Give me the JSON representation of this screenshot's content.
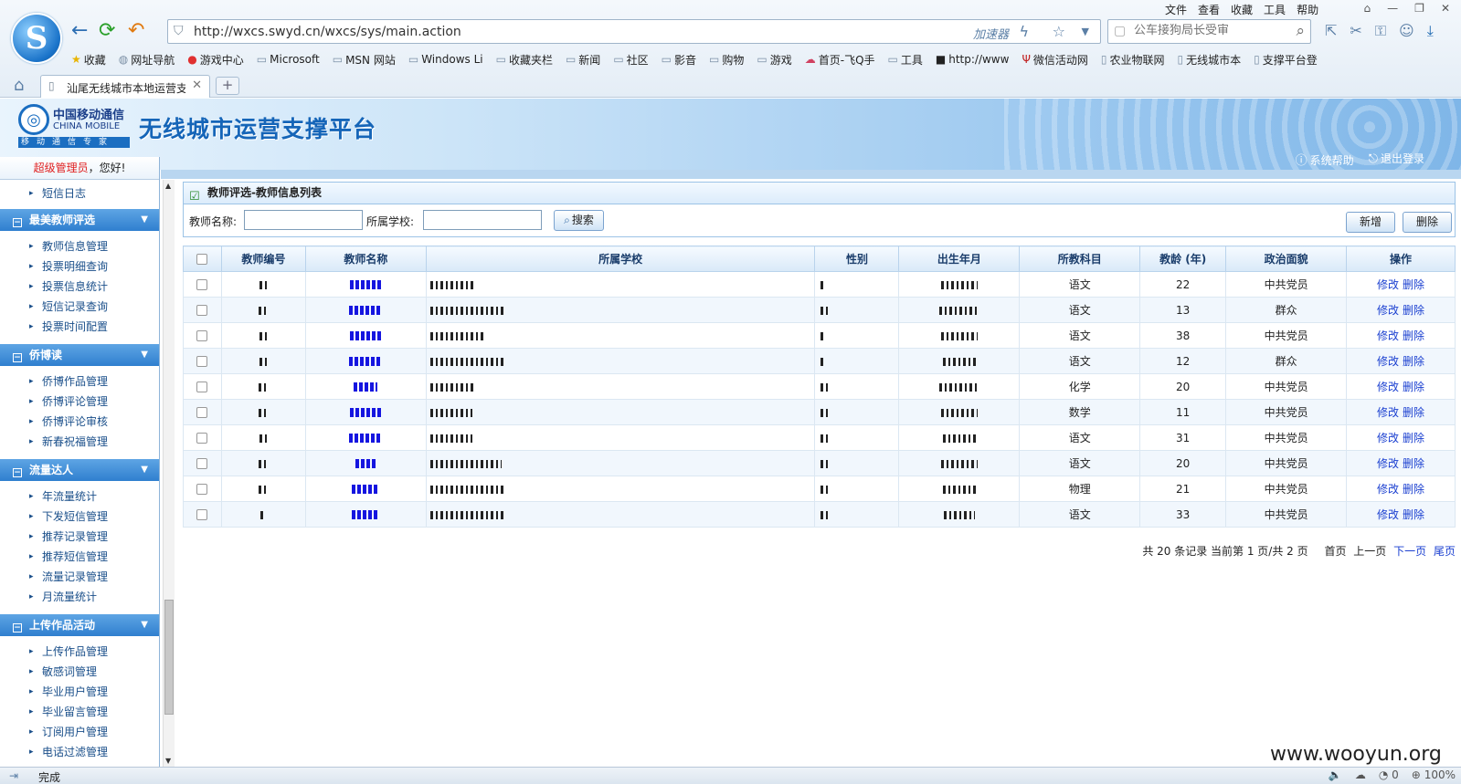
{
  "browser": {
    "url": "http://wxcs.swyd.cn/wxcs/sys/main.action",
    "accelerator_label": "加速器",
    "search_placeholder": "公车接狗局长受审",
    "menu": [
      "文件",
      "查看",
      "收藏",
      "工具",
      "帮助"
    ],
    "favorites": [
      "收藏",
      "网址导航",
      "游戏中心",
      "Microsoft",
      "MSN 网站",
      "Windows Li",
      "收藏夹栏",
      "新闻",
      "社区",
      "影音",
      "购物",
      "游戏",
      "首页-飞Q手",
      "工具",
      "http://www",
      "微信活动网",
      "农业物联网",
      "无线城市本",
      "支撑平台登"
    ],
    "tab_title": "汕尾无线城市本地运营支",
    "new_tab": "+",
    "status": "完成",
    "status_right": [
      "0",
      "100%"
    ]
  },
  "header": {
    "logo_cn": "中国移动通信",
    "logo_en": "CHINA MOBILE",
    "logo_sub": "移动通信专家",
    "title": "无线城市运营支撑平台",
    "help_link": "系统帮助",
    "logout_link": "退出登录"
  },
  "sidebar": {
    "welcome_role": "超级管理员",
    "welcome_suffix": "，您好!",
    "top_items": [
      "短信日志"
    ],
    "groups": [
      {
        "title": "最美教师评选",
        "items": [
          "教师信息管理",
          "投票明细查询",
          "投票信息统计",
          "短信记录查询",
          "投票时间配置"
        ]
      },
      {
        "title": "侨博读",
        "items": [
          "侨博作品管理",
          "侨博评论管理",
          "侨博评论审核",
          "新春祝福管理"
        ]
      },
      {
        "title": "流量达人",
        "items": [
          "年流量统计",
          "下发短信管理",
          "推荐记录管理",
          "推荐短信管理",
          "流量记录管理",
          "月流量统计"
        ]
      },
      {
        "title": "上传作品活动",
        "items": [
          "上传作品管理",
          "敏感词管理",
          "毕业用户管理",
          "毕业留言管理",
          "订阅用户管理",
          "电话过滤管理"
        ]
      }
    ]
  },
  "panel": {
    "title": "教师评选-教师信息列表",
    "label_teacher_name": "教师名称:",
    "label_school": "所属学校:",
    "search_button": "搜索",
    "add_button": "新增",
    "delete_button": "删除"
  },
  "table": {
    "headers": [
      "教师编号",
      "教师名称",
      "所属学校",
      "性别",
      "出生年月",
      "所教科目",
      "教龄 (年)",
      "政治面貌",
      "操作"
    ],
    "edit_label": "修改",
    "delete_label": "删除",
    "rows": [
      {
        "subject": "语文",
        "years": "22",
        "politics": "中共党员"
      },
      {
        "subject": "语文",
        "years": "13",
        "politics": "群众"
      },
      {
        "subject": "语文",
        "years": "38",
        "politics": "中共党员"
      },
      {
        "subject": "语文",
        "years": "12",
        "politics": "群众"
      },
      {
        "subject": "化学",
        "years": "20",
        "politics": "中共党员"
      },
      {
        "subject": "数学",
        "years": "11",
        "politics": "中共党员"
      },
      {
        "subject": "语文",
        "years": "31",
        "politics": "中共党员"
      },
      {
        "subject": "语文",
        "years": "20",
        "politics": "中共党员"
      },
      {
        "subject": "物理",
        "years": "21",
        "politics": "中共党员"
      },
      {
        "subject": "语文",
        "years": "33",
        "politics": "中共党员"
      }
    ]
  },
  "pager": {
    "summary": "共 20 条记录 当前第 1 页/共 2 页",
    "first": "首页",
    "prev": "上一页",
    "next": "下一页",
    "last": "尾页"
  },
  "watermark": "www.wooyun.org"
}
